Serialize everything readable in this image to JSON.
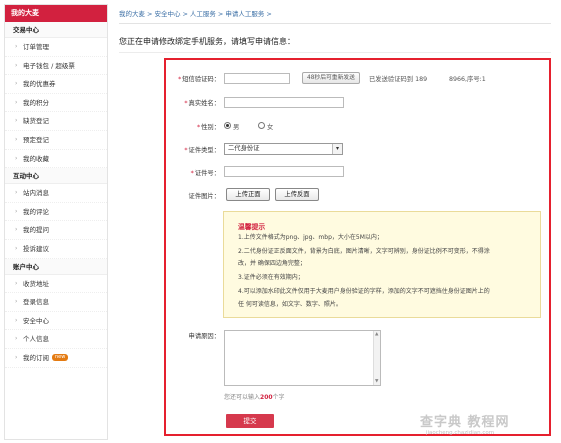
{
  "sidebar": {
    "header": "我的大麦",
    "groups": [
      {
        "title": "交易中心",
        "items": [
          "订单管理",
          "电子钱包 / 超级票",
          "我的优惠券",
          "我的积分",
          "缺货登记",
          "预定登记",
          "我的收藏"
        ]
      },
      {
        "title": "互动中心",
        "items": [
          "站内消息",
          "我的评论",
          "我的提问",
          "投诉建议"
        ]
      },
      {
        "title": "账户中心",
        "items": [
          "收货地址",
          "登录信息",
          "安全中心",
          "个人信息",
          "我的订阅"
        ]
      }
    ],
    "new_badge": "new"
  },
  "breadcrumb": [
    "我的大麦",
    ">",
    "安全中心",
    ">",
    "人工服务",
    ">",
    "申请人工服务",
    ">"
  ],
  "page_title": "您正在申请修改绑定手机服务，请填写申请信息：",
  "form": {
    "sms_code": {
      "label": "短信验证码：",
      "value": "",
      "button": "48秒后可重新发送",
      "status": "已发送验证码到 189",
      "serial": "8966,序号:1"
    },
    "real_name": {
      "label": "真实姓名：",
      "value": ""
    },
    "gender": {
      "label": "性别：",
      "options": [
        "男",
        "女"
      ],
      "selected": "男"
    },
    "id_type": {
      "label": "证件类型：",
      "value": "二代身份证"
    },
    "id_number": {
      "label": "证件号：",
      "value": ""
    },
    "id_photos": {
      "label": "证件图片：",
      "front_button": "上传正面",
      "back_button": "上传反面"
    },
    "reason": {
      "label": "申请原因：",
      "value": ""
    },
    "hint_prefix": "您还可以输入",
    "hint_count": "200",
    "hint_suffix": "个字",
    "submit": "提交"
  },
  "tips": {
    "title": "温馨提示",
    "lines": [
      "1.上传文件格式为png、jpg、mbp，大小在5M以内；",
      "2.二代身份证正反面文件，背景为白底，图片清晰，文字可辨别，身份证比例不可变形，不得涂",
      "改，并 确保四边角完整；",
      "3.证件必须在有效期内；",
      "4.可以添加水印此文件仅用于大麦用户身份验证的字样，添加的文字不可遮挡住身份证图片上的",
      "任 何可读信息，如文字、数字、照片。"
    ]
  },
  "watermark": {
    "main": "查字典 教程网",
    "sub": "jiaocheng.chazidian.com"
  }
}
